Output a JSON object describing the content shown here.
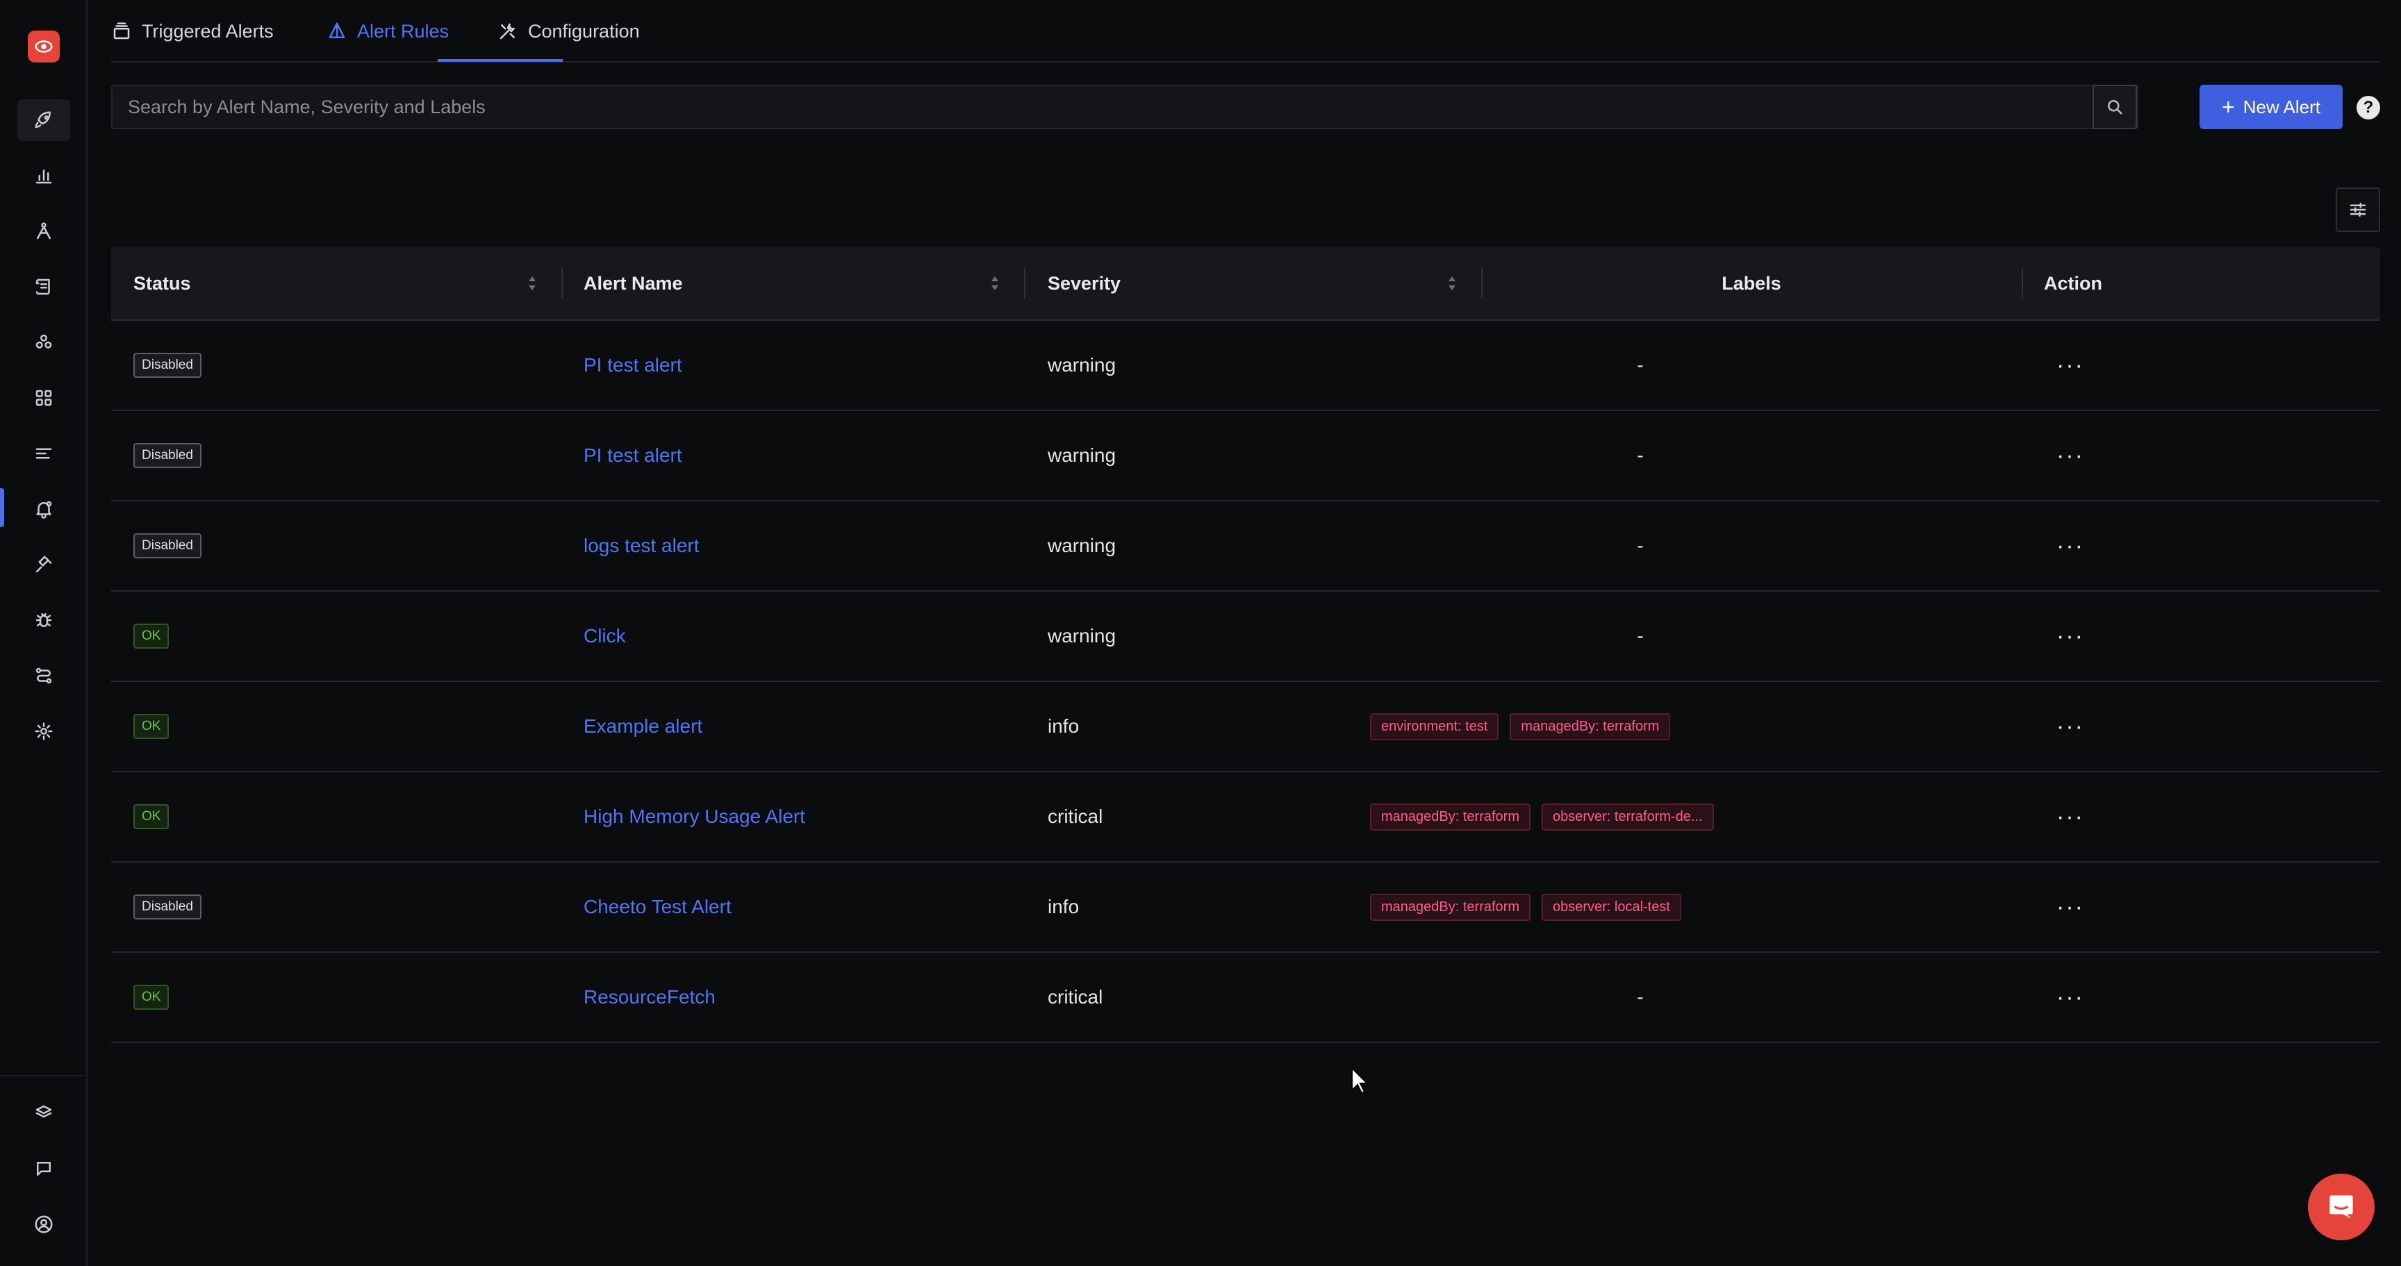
{
  "tabs": [
    {
      "label": "Triggered Alerts",
      "icon": "stack-icon"
    },
    {
      "label": "Alert Rules",
      "icon": "prism-icon"
    },
    {
      "label": "Configuration",
      "icon": "tools-icon"
    }
  ],
  "active_tab": "Alert Rules",
  "search": {
    "placeholder": "Search by Alert Name, Severity and Labels",
    "value": ""
  },
  "new_alert_label": "New Alert",
  "help_label": "?",
  "table": {
    "columns": [
      "Status",
      "Alert Name",
      "Severity",
      "Labels",
      "Action"
    ],
    "rows": [
      {
        "status": "Disabled",
        "name": "PI test alert",
        "severity": "warning",
        "labels": [],
        "empty_label": "-",
        "action": "···"
      },
      {
        "status": "Disabled",
        "name": "PI test alert",
        "severity": "warning",
        "labels": [],
        "empty_label": "-",
        "action": "···"
      },
      {
        "status": "Disabled",
        "name": "logs test alert",
        "severity": "warning",
        "labels": [],
        "empty_label": "-",
        "action": "···"
      },
      {
        "status": "OK",
        "name": "Click",
        "severity": "warning",
        "labels": [],
        "empty_label": "-",
        "action": "···"
      },
      {
        "status": "OK",
        "name": "Example alert",
        "severity": "info",
        "labels": [
          "environment: test",
          "managedBy: terraform"
        ],
        "action": "···"
      },
      {
        "status": "OK",
        "name": "High Memory Usage Alert",
        "severity": "critical",
        "labels": [
          "managedBy: terraform",
          "observer: terraform-de..."
        ],
        "action": "···"
      },
      {
        "status": "Disabled",
        "name": "Cheeto Test Alert",
        "severity": "info",
        "labels": [
          "managedBy: terraform",
          "observer: local-test"
        ],
        "action": "···"
      },
      {
        "status": "OK",
        "name": "ResourceFetch",
        "severity": "critical",
        "labels": [],
        "empty_label": "-",
        "action": "···"
      }
    ]
  },
  "sidebar_icons": [
    "logo-eye-icon",
    "rocket-icon",
    "bar-chart-icon",
    "trace-icon",
    "logs-icon",
    "cluster-icon",
    "dashboard-grid-icon",
    "list-icon",
    "alerts-bell-icon",
    "integrations-plug-icon",
    "bug-icon",
    "pipelines-icon",
    "settings-gear-icon",
    "layers-icon",
    "chat-icon",
    "user-circle-icon"
  ],
  "colors": {
    "accent": "#4e6ef2",
    "brand": "#e5443a",
    "ok": "#6cc24a",
    "label": "#ff5d8a"
  }
}
